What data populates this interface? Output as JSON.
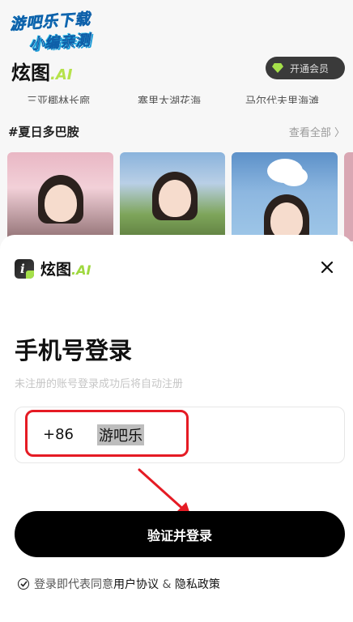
{
  "watermark": {
    "line1": "游吧乐下载",
    "line2": "小编亲测"
  },
  "app": {
    "logo_text": "炫图",
    "logo_ai": ".AI",
    "vip_label": "开通会员"
  },
  "categories": [
    "三亚椰林长廊",
    "寨里太湖花海",
    "马尔代夫里海滩"
  ],
  "section": {
    "title": "#夏日多巴胺",
    "see_all": "查看全部 〉"
  },
  "thumbnails": [
    "cherry-blossom-portrait",
    "field-portrait",
    "cloud-portrait"
  ],
  "sheet": {
    "logo_text": "炫图",
    "logo_ai": ".AI",
    "title": "手机号登录",
    "subtitle": "未注册的账号登录成功后将自动注册",
    "country_code": "+86",
    "phone_value": "游吧乐",
    "submit_label": "验证并登录",
    "agree_prefix": "登录即代表同意",
    "agree_terms": "用户协议",
    "agree_and": " & ",
    "agree_privacy": "隐私政策"
  },
  "colors": {
    "accent_green": "#a5e04a",
    "highlight_red": "#e51b24"
  },
  "icons": {
    "close": "close-icon",
    "vip": "gem-icon",
    "check": "check-circle-icon"
  }
}
